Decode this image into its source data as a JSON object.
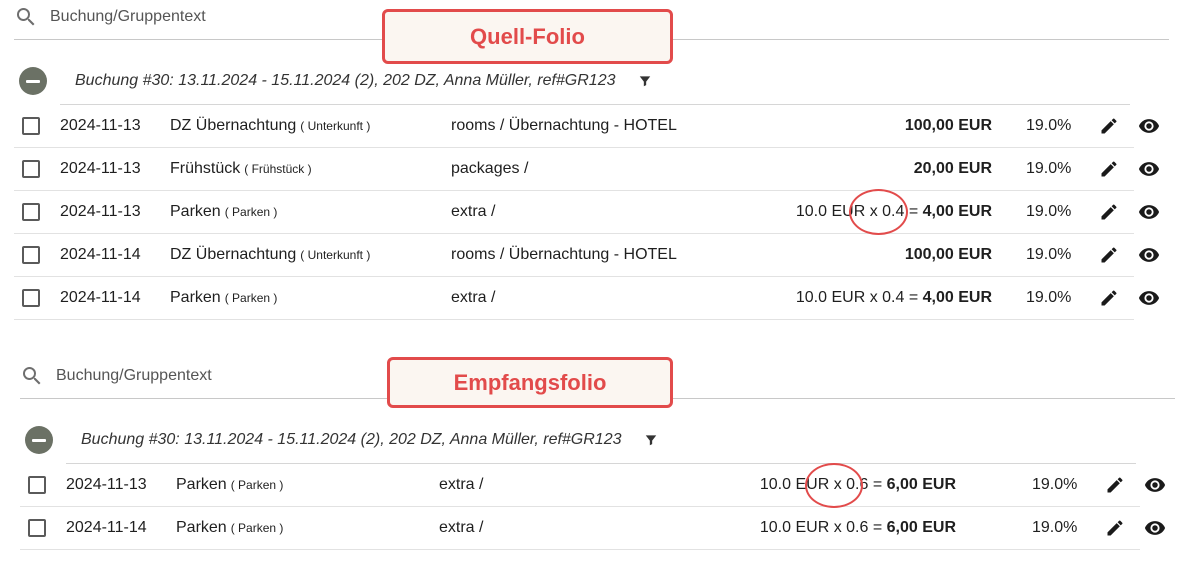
{
  "source": {
    "search": {
      "placeholder": "Buchung/Gruppentext"
    },
    "callout": "Quell-Folio",
    "group_title": "Buchung #30: 13.11.2024 - 15.11.2024 (2), 202 DZ, Anna Müller, ref#GR123",
    "rows": [
      {
        "date": "2024-11-13",
        "name": "DZ Übernachtung",
        "category": "( Unterkunft )",
        "account": "rooms / Übernachtung - HOTEL",
        "calc": "",
        "amount": "100,00 EUR",
        "vat": "19.0%"
      },
      {
        "date": "2024-11-13",
        "name": "Frühstück",
        "category": "( Frühstück )",
        "account": "packages /",
        "calc": "",
        "amount": "20,00 EUR",
        "vat": "19.0%"
      },
      {
        "date": "2024-11-13",
        "name": "Parken",
        "category": "( Parken )",
        "account": "extra /",
        "calc": "10.0 EUR x 0.4 =",
        "amount": "4,00 EUR",
        "vat": "19.0%"
      },
      {
        "date": "2024-11-14",
        "name": "DZ Übernachtung",
        "category": "( Unterkunft )",
        "account": "rooms / Übernachtung - HOTEL",
        "calc": "",
        "amount": "100,00 EUR",
        "vat": "19.0%"
      },
      {
        "date": "2024-11-14",
        "name": "Parken",
        "category": "( Parken )",
        "account": "extra /",
        "calc": "10.0 EUR x 0.4 =",
        "amount": "4,00 EUR",
        "vat": "19.0%"
      }
    ]
  },
  "target": {
    "search": {
      "placeholder": "Buchung/Gruppentext"
    },
    "callout": "Empfangsfolio",
    "group_title": "Buchung #30: 13.11.2024 - 15.11.2024 (2), 202 DZ, Anna Müller, ref#GR123",
    "rows": [
      {
        "date": "2024-11-13",
        "name": "Parken",
        "category": "( Parken )",
        "account": "extra /",
        "calc": "10.0 EUR x 0.6 =",
        "amount": "6,00 EUR",
        "vat": "19.0%"
      },
      {
        "date": "2024-11-14",
        "name": "Parken",
        "category": "( Parken )",
        "account": "extra /",
        "calc": "10.0 EUR x 0.6 =",
        "amount": "6,00 EUR",
        "vat": "19.0%"
      }
    ]
  },
  "icons": {
    "search": "search-icon",
    "collapse": "minus-circle-icon",
    "filter": "filter-icon",
    "edit": "pencil-icon",
    "view": "eye-icon"
  },
  "colors": {
    "accent": "#e24b4b",
    "collapse_button": "#6b7165",
    "callout_bg": "#fbf6f1"
  }
}
